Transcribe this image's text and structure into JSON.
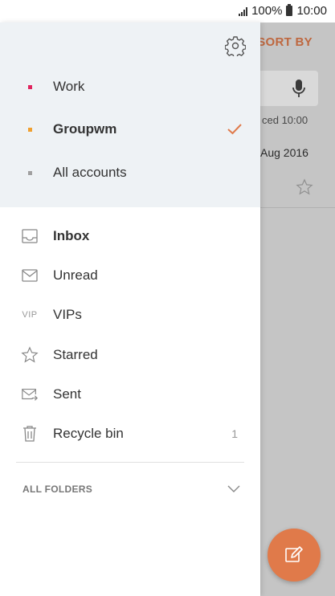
{
  "status_bar": {
    "battery_text": "100%",
    "time": "10:00"
  },
  "background": {
    "sort_by_label": "SORT BY",
    "synced_text": "ced  10:00",
    "date_text": "Aug 2016"
  },
  "drawer": {
    "accounts": [
      {
        "label": "Work",
        "color": "#e0245e",
        "selected": false
      },
      {
        "label": "Groupwm",
        "color": "#f0a030",
        "selected": true
      },
      {
        "label": "All accounts",
        "color": "#a0a0a0",
        "selected": false
      }
    ],
    "folders": [
      {
        "label": "Inbox",
        "icon": "inbox-icon",
        "count": ""
      },
      {
        "label": "Unread",
        "icon": "envelope-icon",
        "count": ""
      },
      {
        "label": "VIPs",
        "icon": "vip-icon",
        "icon_text": "VIP",
        "count": ""
      },
      {
        "label": "Starred",
        "icon": "star-icon",
        "count": ""
      },
      {
        "label": "Sent",
        "icon": "sent-icon",
        "count": ""
      },
      {
        "label": "Recycle bin",
        "icon": "trash-icon",
        "count": "1"
      }
    ],
    "all_folders_label": "ALL FOLDERS"
  },
  "colors": {
    "accent": "#e07a4a",
    "check": "#e07a4a"
  }
}
